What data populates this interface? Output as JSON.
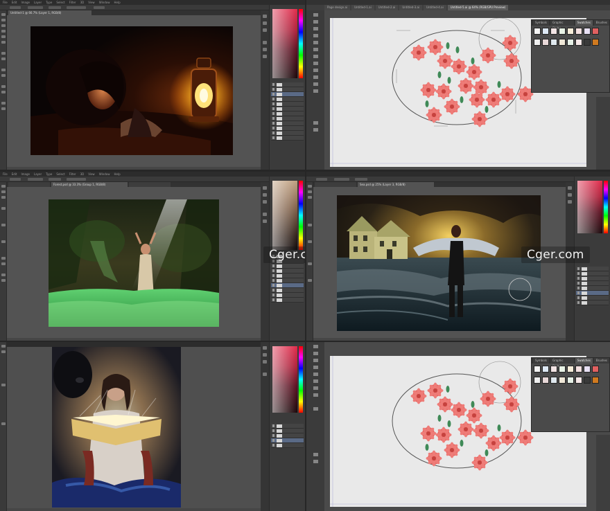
{
  "app": {
    "menu_items": [
      "File",
      "Edit",
      "Image",
      "Layer",
      "Type",
      "Select",
      "Filter",
      "3D",
      "View",
      "Window",
      "Help"
    ]
  },
  "panels": [
    {
      "id": "lantern",
      "tabs": [
        "Untitled-1 @ 66.7% (Layer 1, RGB/8)"
      ]
    },
    {
      "id": "flowers-1",
      "tabs": [
        "Page design.ai",
        "Untitled-1.ai",
        "Untitled-2.ai",
        "Untitled-3.ai",
        "Untitled-4.ai",
        "Untitled-5.ai @ 64% (RGB/GPU Preview)"
      ],
      "swatch_tabs": [
        "Symbols",
        "Graphic Styles",
        "Swatches",
        "Brushes"
      ]
    },
    {
      "id": "forest",
      "tabs": [
        "Forest.psd @ 33.3% (Group 1, RGB/8)"
      ]
    },
    {
      "id": "house",
      "tabs": [
        "Sea.psd @ 25% (Layer 3, RGB/8)"
      ]
    },
    {
      "id": "book",
      "tabs": [
        "Book.psd @ 50% (Layer 2, RGB/8)"
      ]
    },
    {
      "id": "flowers-2",
      "tabs": [
        "Page design.ai",
        "Untitled-1.ai",
        "Untitled-2.ai",
        "Untitled-3.ai",
        "Untitled-4.ai",
        "Untitled-5.ai @ 64% (RGB/GPU Preview)"
      ],
      "swatch_tabs": [
        "Symbols",
        "Graphic Styles",
        "Swatches",
        "Brushes"
      ]
    }
  ],
  "watermarks": {
    "left": "Cger.com",
    "right": "Cger.com"
  },
  "colors": {
    "ui_dark": "#3a3a3a",
    "canvas_gray": "#535353",
    "flower_red": "#e4605c",
    "leaf_green": "#3f8a57"
  }
}
